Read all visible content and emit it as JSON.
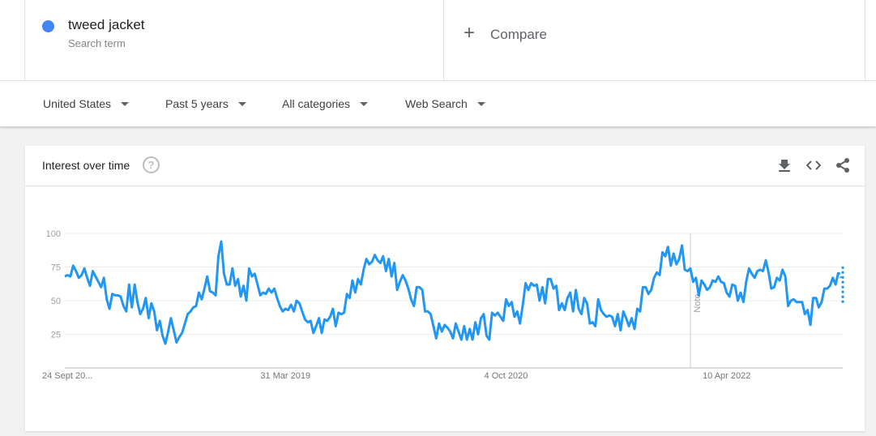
{
  "search_term": {
    "name": "tweed jacket",
    "subtitle": "Search term",
    "color": "#4285f4"
  },
  "compare": {
    "label": "Compare",
    "icon": "plus-icon"
  },
  "filters": [
    {
      "label": "United States"
    },
    {
      "label": "Past 5 years"
    },
    {
      "label": "All categories"
    },
    {
      "label": "Web Search"
    }
  ],
  "card": {
    "title": "Interest over time",
    "help_icon": "help-circle-icon",
    "actions": [
      "download-icon",
      "embed-code-icon",
      "share-icon"
    ]
  },
  "chart_data": {
    "type": "line",
    "title": "Interest over time",
    "xlabel": "",
    "ylabel": "",
    "ylim": [
      0,
      100
    ],
    "yticks": [
      25,
      50,
      75,
      100
    ],
    "grid": true,
    "line_color": "#2196f3",
    "x_tick_labels": [
      "24 Sept 20...",
      "31 Mar 2019",
      "4 Oct 2020",
      "10 Apr 2022"
    ],
    "x_tick_index": [
      0,
      79,
      158,
      237
    ],
    "note": {
      "label": "Note",
      "index": 224
    },
    "partial_last_point": true,
    "series": [
      {
        "name": "tweed jacket",
        "values": [
          68,
          69,
          68,
          76,
          72,
          67,
          69,
          74,
          67,
          61,
          72,
          68,
          64,
          60,
          67,
          51,
          44,
          55,
          54,
          54,
          53,
          46,
          42,
          62,
          45,
          62,
          49,
          40,
          44,
          52,
          37,
          48,
          42,
          28,
          35,
          24,
          18,
          27,
          37,
          28,
          19,
          23,
          26,
          33,
          40,
          42,
          45,
          46,
          56,
          51,
          59,
          68,
          57,
          56,
          54,
          83,
          94,
          70,
          62,
          62,
          74,
          61,
          66,
          53,
          61,
          50,
          74,
          68,
          70,
          62,
          54,
          56,
          55,
          59,
          56,
          59,
          52,
          46,
          42,
          44,
          43,
          47,
          42,
          50,
          48,
          42,
          36,
          34,
          35,
          26,
          31,
          37,
          26,
          36,
          35,
          38,
          44,
          31,
          41,
          40,
          41,
          55,
          52,
          65,
          56,
          66,
          62,
          73,
          81,
          77,
          79,
          84,
          80,
          78,
          83,
          72,
          81,
          68,
          78,
          58,
          64,
          69,
          65,
          59,
          51,
          46,
          60,
          60,
          58,
          42,
          42,
          40,
          31,
          22,
          33,
          27,
          32,
          30,
          27,
          22,
          33,
          27,
          21,
          31,
          21,
          29,
          21,
          34,
          25,
          37,
          40,
          24,
          21,
          41,
          39,
          41,
          38,
          35,
          51,
          46,
          49,
          38,
          42,
          33,
          47,
          63,
          58,
          63,
          61,
          62,
          50,
          60,
          48,
          66,
          66,
          59,
          61,
          43,
          48,
          43,
          52,
          56,
          42,
          58,
          44,
          40,
          52,
          48,
          33,
          34,
          31,
          51,
          43,
          40,
          38,
          39,
          38,
          31,
          40,
          28,
          42,
          37,
          31,
          37,
          29,
          44,
          42,
          60,
          60,
          55,
          58,
          67,
          71,
          69,
          86,
          83,
          90,
          76,
          85,
          77,
          81,
          91,
          73,
          72,
          74,
          64,
          67,
          54,
          65,
          62,
          58,
          60,
          65,
          64,
          68,
          64,
          63,
          56,
          53,
          62,
          61,
          50,
          56,
          49,
          64,
          74,
          70,
          67,
          72,
          73,
          72,
          80,
          71,
          59,
          60,
          67,
          65,
          73,
          68,
          46,
          50,
          51,
          49,
          49,
          49,
          40,
          43,
          32,
          52,
          52,
          45,
          49,
          59,
          59,
          61,
          67,
          62,
          71,
          67
        ]
      }
    ]
  }
}
